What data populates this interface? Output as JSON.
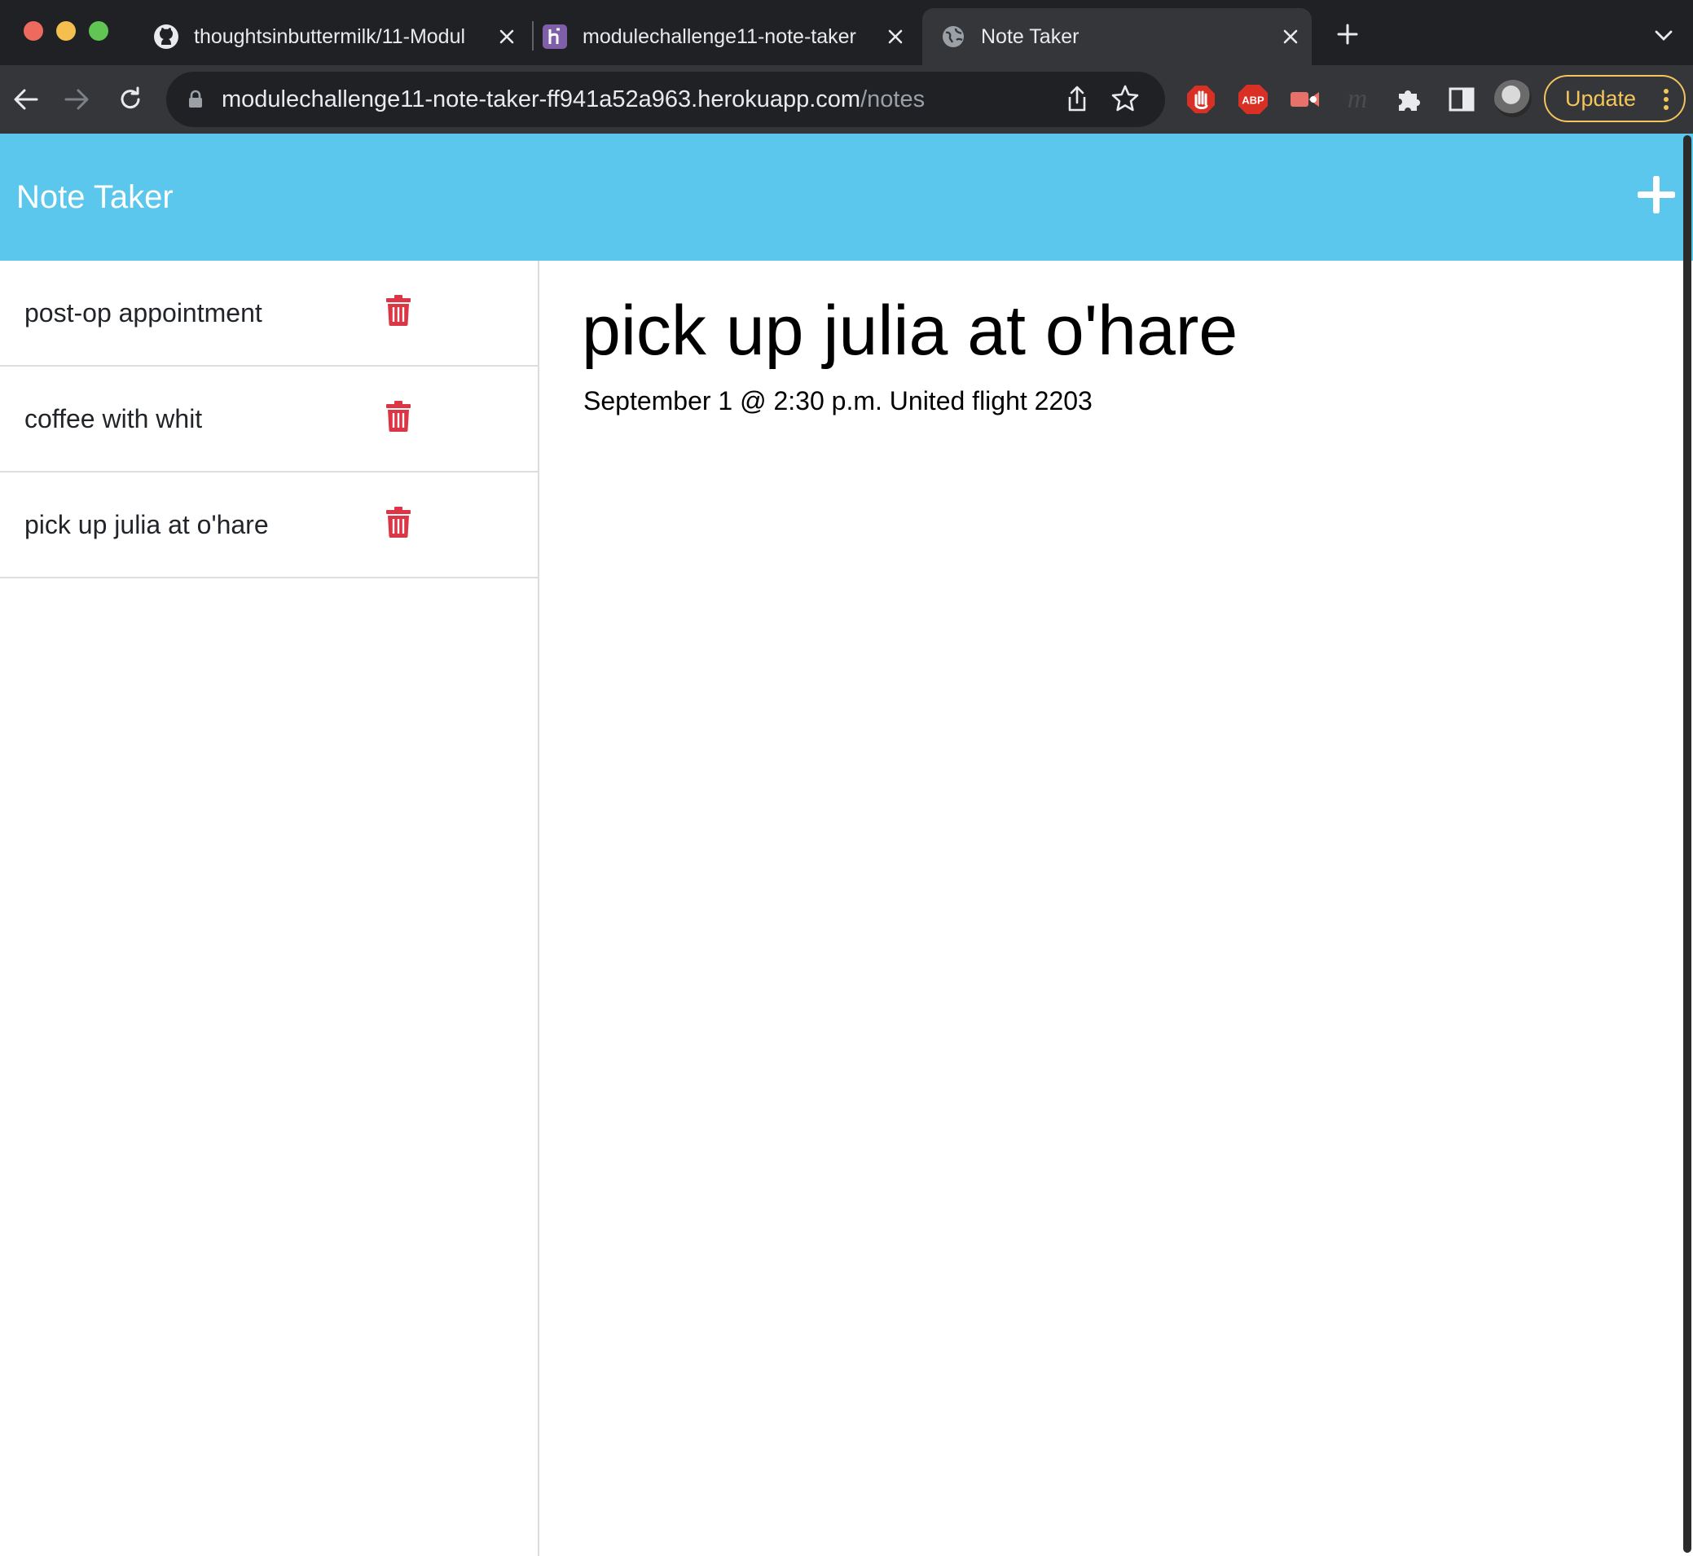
{
  "browser": {
    "tabs": [
      {
        "title": "thoughtsinbuttermilk/11-Modul",
        "favicon": "github-icon"
      },
      {
        "title": "modulechallenge11-note-taker",
        "favicon": "heroku-icon"
      },
      {
        "title": "Note Taker",
        "favicon": "globe-icon",
        "active": true
      }
    ],
    "address": {
      "host": "modulechallenge11-note-taker-ff941a52a963.herokuapp.com",
      "path": "/notes"
    },
    "extensions": [
      "adblock-hand-icon",
      "abp-icon",
      "screen-recorder-icon",
      "m-icon",
      "puzzle-icon",
      "side-panel-icon"
    ],
    "abp_label": "ABP",
    "update_label": "Update",
    "colors": {
      "chrome_dark": "#202124",
      "chrome_toolbar": "#35363a",
      "update_accent": "#f3c55b"
    }
  },
  "app": {
    "brand": "Note Taker",
    "colors": {
      "navbar": "#5bc7ed",
      "delete": "#dc3545"
    }
  },
  "sidebar": {
    "notes": [
      {
        "title": "post-op appointment"
      },
      {
        "title": "coffee with whit"
      },
      {
        "title": "pick up julia at o'hare"
      }
    ]
  },
  "editor": {
    "title": "pick up julia at o'hare",
    "text": "September 1 @ 2:30 p.m. United flight 2203"
  }
}
